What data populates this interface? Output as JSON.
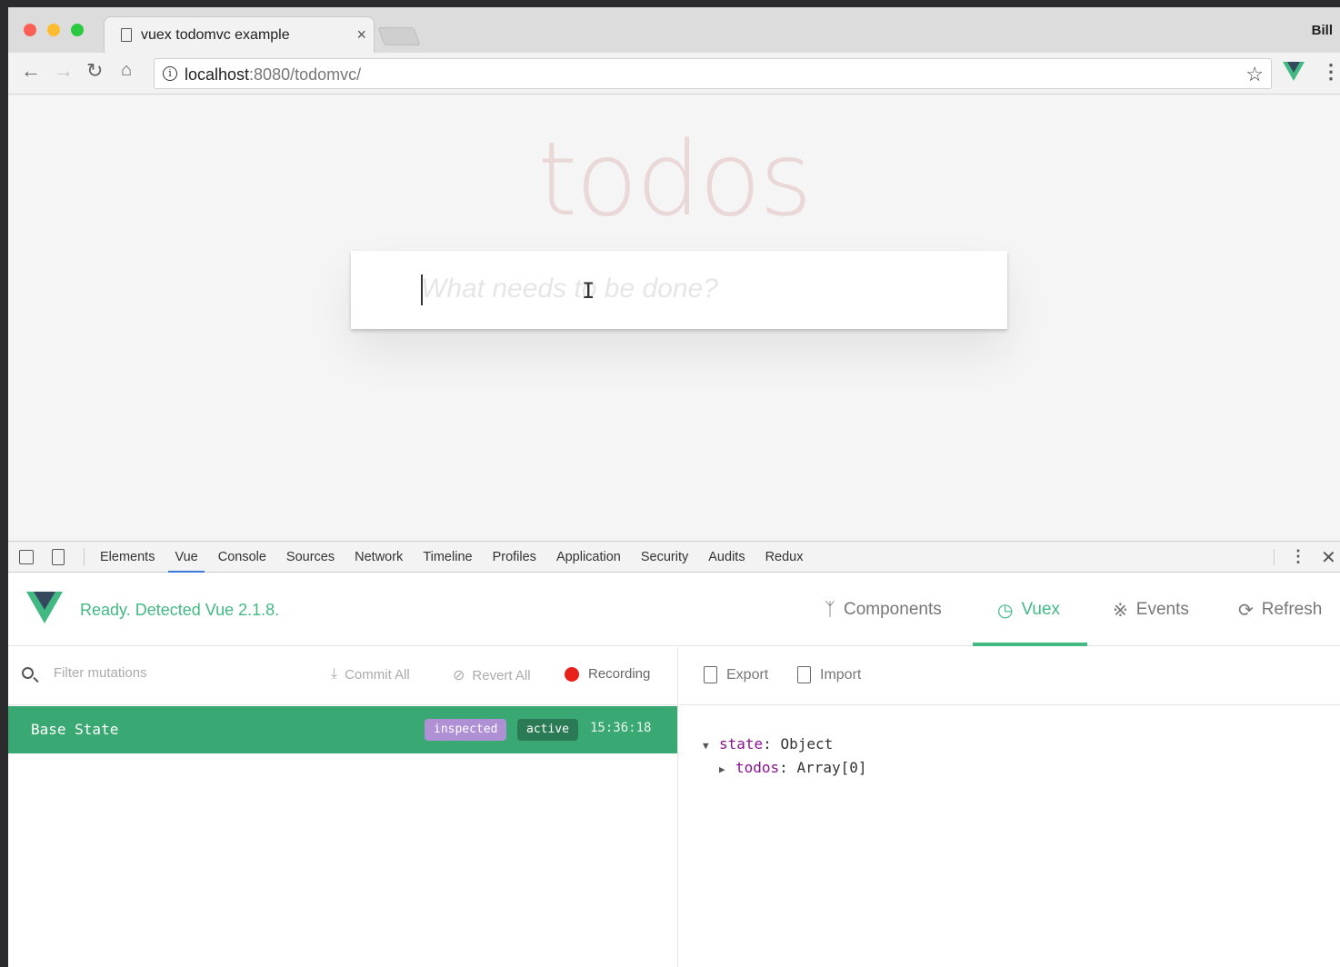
{
  "browser": {
    "tab_title": "vuex todomvc example",
    "tab_close": "×",
    "profile_name": "Bill",
    "url_host": "localhost",
    "url_rest": ":8080/todomvc/"
  },
  "page": {
    "title": "todos",
    "input_placeholder": "What needs to be done?"
  },
  "devtools": {
    "tabs": [
      "Elements",
      "Vue",
      "Console",
      "Sources",
      "Network",
      "Timeline",
      "Profiles",
      "Application",
      "Security",
      "Audits",
      "Redux"
    ],
    "active_tab": "Vue"
  },
  "vue": {
    "status": "Ready. Detected Vue 2.1.8.",
    "nav": {
      "components": "Components",
      "vuex": "Vuex",
      "events": "Events",
      "refresh": "Refresh"
    },
    "mutations": {
      "filter_placeholder": "Filter mutations",
      "commit_all": "Commit All",
      "revert_all": "Revert All",
      "recording": "Recording"
    },
    "base_state": {
      "label": "Base State",
      "badge_inspected": "inspected",
      "badge_active": "active",
      "time": "15:36:18"
    },
    "inspector": {
      "export": "Export",
      "import": "Import",
      "state_key": "state",
      "state_value": "Object",
      "todos_key": "todos",
      "todos_value": "Array[0]"
    }
  },
  "colors": {
    "vue_green": "#42b983",
    "row_green": "#3aa872",
    "badge_purple": "#af90d5",
    "record_red": "#e8201b"
  }
}
